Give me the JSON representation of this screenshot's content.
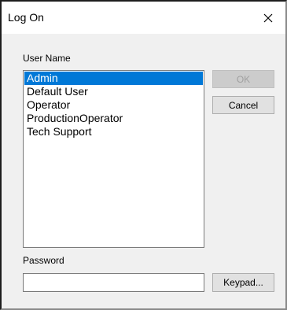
{
  "window": {
    "title": "Log On",
    "close_icon": "close-icon"
  },
  "user_list": {
    "label": "User Name",
    "items": [
      "Admin",
      "Default User",
      "Operator",
      "ProductionOperator",
      "Tech Support"
    ],
    "selected": "Admin"
  },
  "buttons": {
    "ok_label": "OK",
    "cancel_label": "Cancel",
    "keypad_label": "Keypad..."
  },
  "password": {
    "label": "Password",
    "value": ""
  },
  "colors": {
    "selection": "#0078d7",
    "dialog_bg": "#f0f0f0"
  }
}
